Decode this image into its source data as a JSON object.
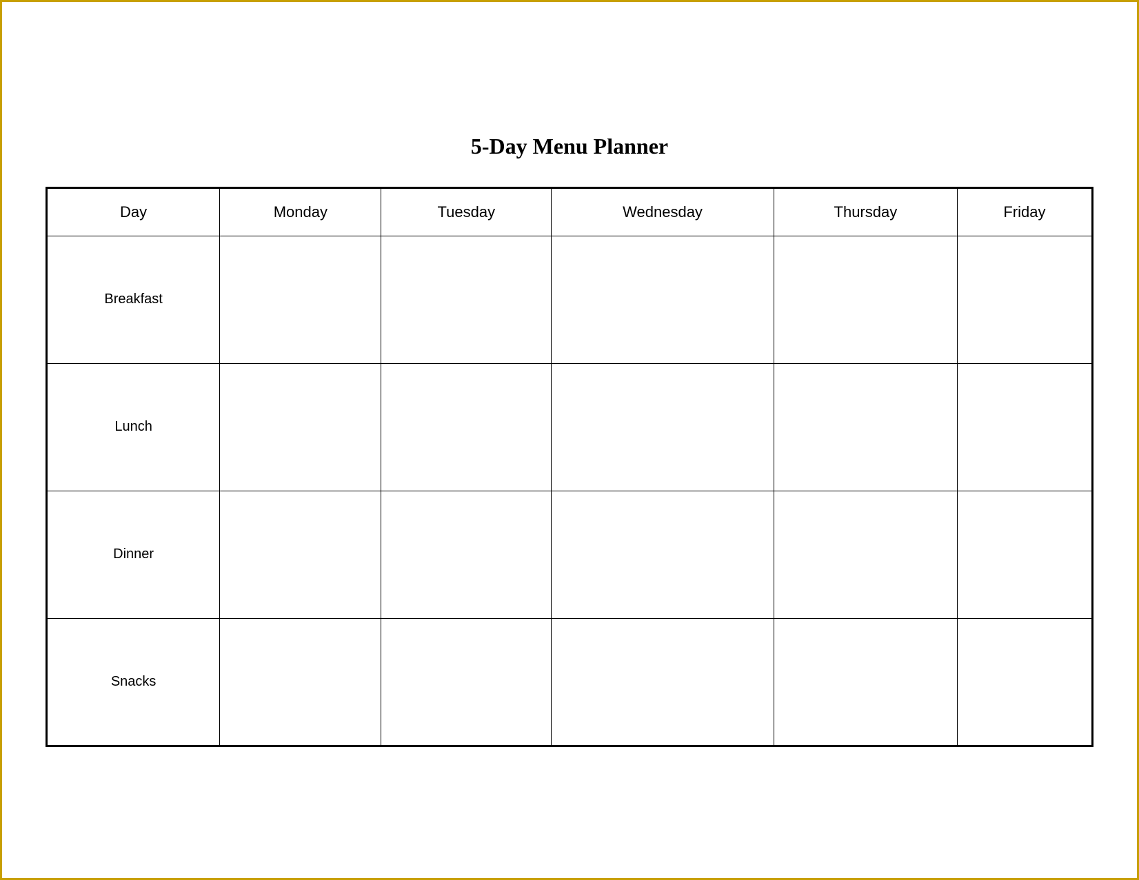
{
  "title": "5-Day Menu Planner",
  "columns": {
    "day": "Day",
    "monday": "Monday",
    "tuesday": "Tuesday",
    "wednesday": "Wednesday",
    "thursday": "Thursday",
    "friday": "Friday"
  },
  "rows": [
    {
      "label": "Breakfast"
    },
    {
      "label": "Lunch"
    },
    {
      "label": "Dinner"
    },
    {
      "label": "Snacks"
    }
  ]
}
